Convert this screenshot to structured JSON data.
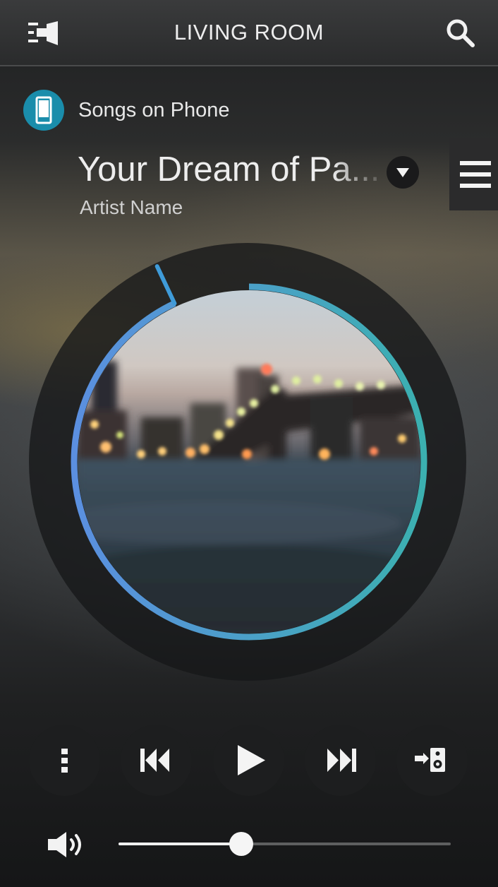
{
  "header": {
    "room_name": "LIVING ROOM",
    "rooms_icon": "rooms-menu-icon",
    "search_icon": "search-icon"
  },
  "source": {
    "label": "Songs on Phone",
    "icon": "phone-icon",
    "accent_color": "#1a8dab"
  },
  "track": {
    "title": "Your Dream of Pa...",
    "artist": "Artist Name",
    "options_icon": "triangle-down-icon"
  },
  "queue": {
    "icon": "hamburger-menu-icon"
  },
  "progress": {
    "fraction": 0.93,
    "color_start": "#5b8fe0",
    "color_end": "#3bb0b0"
  },
  "controls": [
    {
      "name": "more-options",
      "icon": "vertical-dots-icon"
    },
    {
      "name": "previous",
      "icon": "skip-previous-icon"
    },
    {
      "name": "play",
      "icon": "play-icon"
    },
    {
      "name": "next",
      "icon": "skip-next-icon"
    },
    {
      "name": "group-speakers",
      "icon": "speaker-group-icon"
    }
  ],
  "volume": {
    "level": 0.37,
    "icon": "speaker-volume-icon"
  }
}
